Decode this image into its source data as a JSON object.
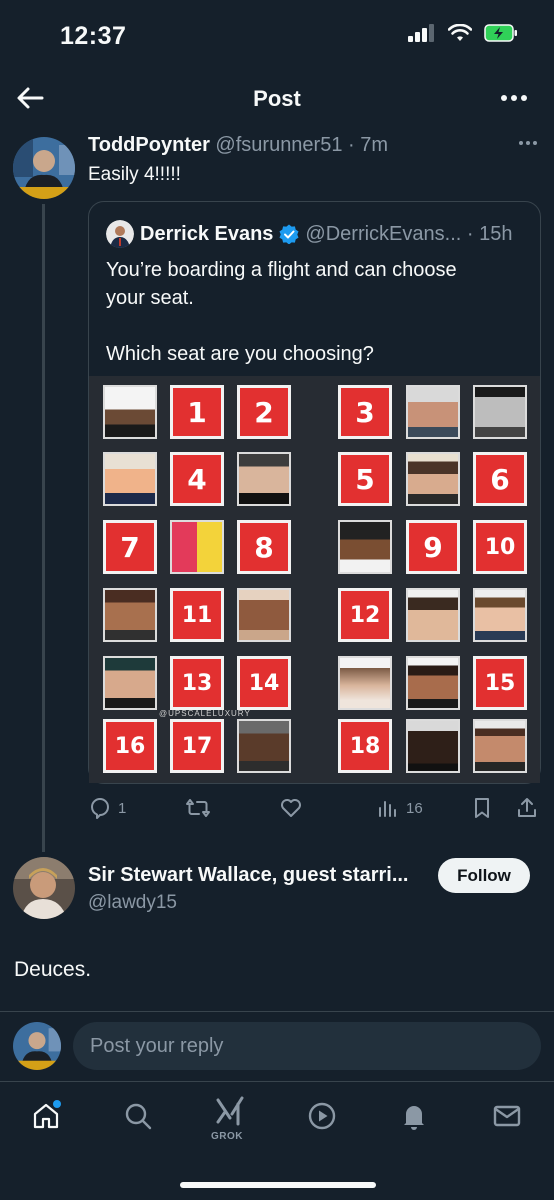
{
  "status_bar": {
    "time": "12:37"
  },
  "header": {
    "title": "Post"
  },
  "post": {
    "author_name": "ToddPoynter",
    "author_handle_time": "@fsurunner51 · 7m",
    "text": "Easily 4!!!!!",
    "quote": {
      "author_name": "Derrick Evans",
      "author_handle_time": "@DerrickEvans... · 15h",
      "text_line1": "You’re boarding a flight and can choose",
      "text_line2": "your seat.",
      "text_line3": "Which seat are you choosing?",
      "image_watermark": "@UPSCALELUXURY",
      "seats": [
        "1",
        "2",
        "3",
        "4",
        "5",
        "6",
        "7",
        "8",
        "9",
        "10",
        "11",
        "12",
        "13",
        "14",
        "15",
        "16",
        "17",
        "18"
      ]
    },
    "actions": {
      "replies": "1",
      "views": "16"
    }
  },
  "reply": {
    "author_name": "Sir Stewart Wallace, guest starri...",
    "author_handle": "@lawdy15",
    "text": "Deuces.",
    "follow_label": "Follow"
  },
  "composer": {
    "placeholder": "Post your reply"
  },
  "tab_bar": {
    "grok_label": "GROK"
  },
  "colors": {
    "background": "#15202b",
    "accent": "#1d9bf0",
    "seat_red": "#e23030",
    "muted": "#8b98a5"
  }
}
